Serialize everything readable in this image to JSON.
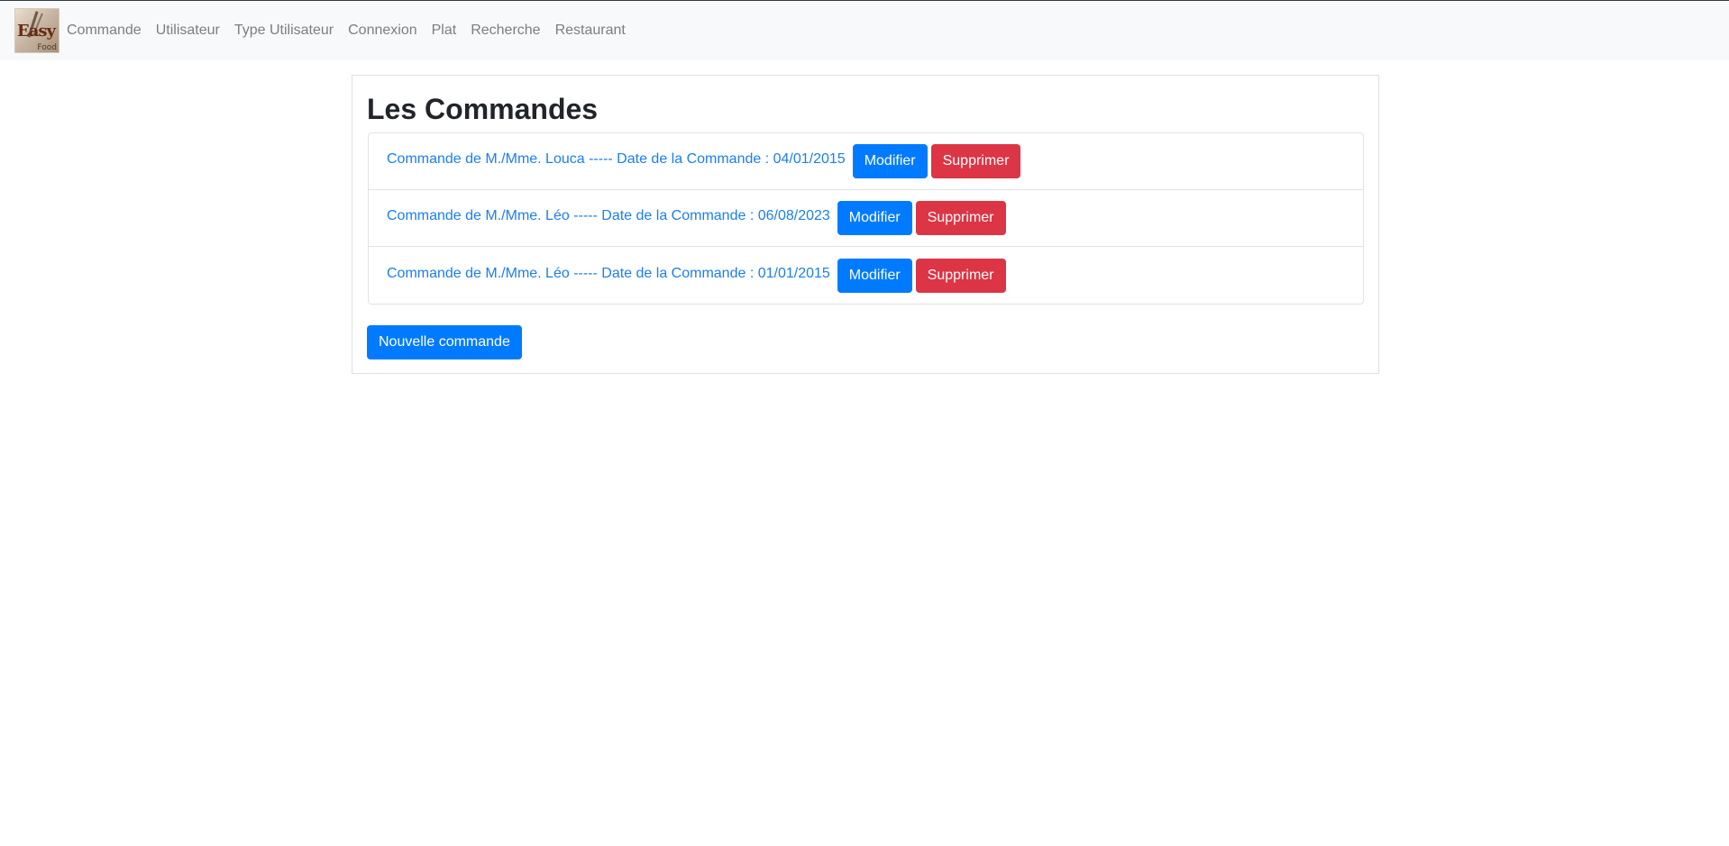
{
  "navbar": {
    "logo_text_main": "Easy",
    "logo_text_sub": "Food",
    "links": [
      "Commande",
      "Utilisateur",
      "Type Utilisateur",
      "Connexion",
      "Plat",
      "Recherche",
      "Restaurant"
    ]
  },
  "page": {
    "title": "Les Commandes",
    "new_button": "Nouvelle commande"
  },
  "orders": [
    {
      "label": "Commande de M./Mme. Louca ----- Date de la Commande : 04/01/2015",
      "edit": "Modifier",
      "delete": "Supprimer"
    },
    {
      "label": "Commande de M./Mme. Léo ----- Date de la Commande : 06/08/2023",
      "edit": "Modifier",
      "delete": "Supprimer"
    },
    {
      "label": "Commande de M./Mme. Léo ----- Date de la Commande : 01/01/2015",
      "edit": "Modifier",
      "delete": "Supprimer"
    }
  ],
  "colors": {
    "primary": "#007bff",
    "danger": "#dc3545",
    "link": "#1a7ff0",
    "navbar_bg": "#f8f9fa"
  }
}
